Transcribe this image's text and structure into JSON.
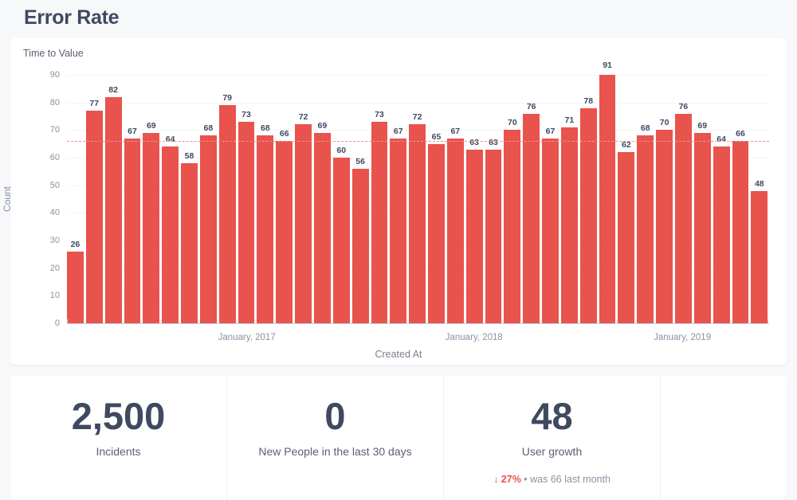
{
  "page": {
    "title": "Error Rate"
  },
  "chart_card": {
    "title": "Time to Value"
  },
  "chart_data": {
    "type": "bar",
    "title": "Time to Value",
    "xlabel": "Created At",
    "ylabel": "Count",
    "ylim": [
      0,
      90
    ],
    "yticks": [
      0,
      10,
      20,
      30,
      40,
      50,
      60,
      70,
      80,
      90
    ],
    "grid": true,
    "legend": null,
    "bar_color": "#e8534d",
    "reference_line": {
      "value": 66,
      "style": "dashed",
      "color": "#f1928d"
    },
    "xtick_labels": [
      "January, 2017",
      "January, 2018",
      "January, 2019"
    ],
    "xtick_indices": [
      9,
      21,
      32
    ],
    "values": [
      26,
      77,
      82,
      67,
      69,
      64,
      58,
      68,
      79,
      73,
      68,
      66,
      72,
      69,
      60,
      56,
      73,
      67,
      72,
      65,
      67,
      63,
      63,
      70,
      76,
      67,
      71,
      78,
      91,
      62,
      68,
      70,
      76,
      69,
      64,
      66,
      48
    ]
  },
  "stats": [
    {
      "value": "2,500",
      "label": "Incidents"
    },
    {
      "value": "0",
      "label": "New People in the last 30 days"
    },
    {
      "value": "48",
      "label": "User growth",
      "delta_arrow": "↓",
      "delta_pct": "27%",
      "delta_sep": "•",
      "delta_note": "was 66 last month"
    }
  ]
}
